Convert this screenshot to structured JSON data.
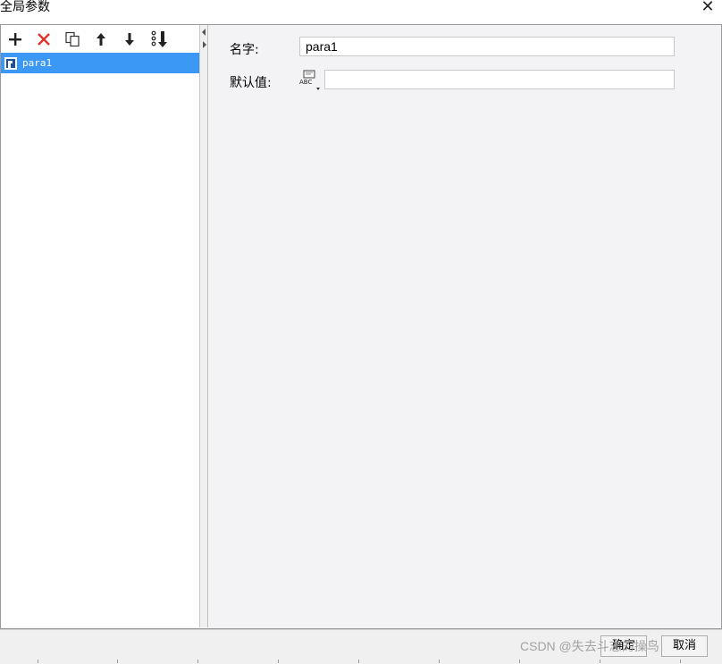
{
  "window": {
    "title": "全局参数",
    "close_glyph": "✕"
  },
  "toolbar": [
    {
      "name": "add-button",
      "icon": "plus-icon"
    },
    {
      "name": "delete-button",
      "icon": "x-icon"
    },
    {
      "name": "copy-button",
      "icon": "copy-icon"
    },
    {
      "name": "move-up-button",
      "icon": "arrow-up-icon"
    },
    {
      "name": "move-down-button",
      "icon": "arrow-down-icon"
    },
    {
      "name": "sort-button",
      "icon": "sort-icon"
    }
  ],
  "tree": {
    "items": [
      {
        "label": "para1",
        "selected": true
      }
    ]
  },
  "form": {
    "name_label": "名字:",
    "name_value": "para1",
    "default_label": "默认值:",
    "default_value": ""
  },
  "footer": {
    "ok_label": "确定",
    "cancel_label": "取消"
  },
  "watermark": "CSDN @失去斗志的操鸟",
  "colors": {
    "selection": "#3b99f5",
    "delete_red": "#e0332b",
    "panel_bg": "#f3f3f5"
  }
}
